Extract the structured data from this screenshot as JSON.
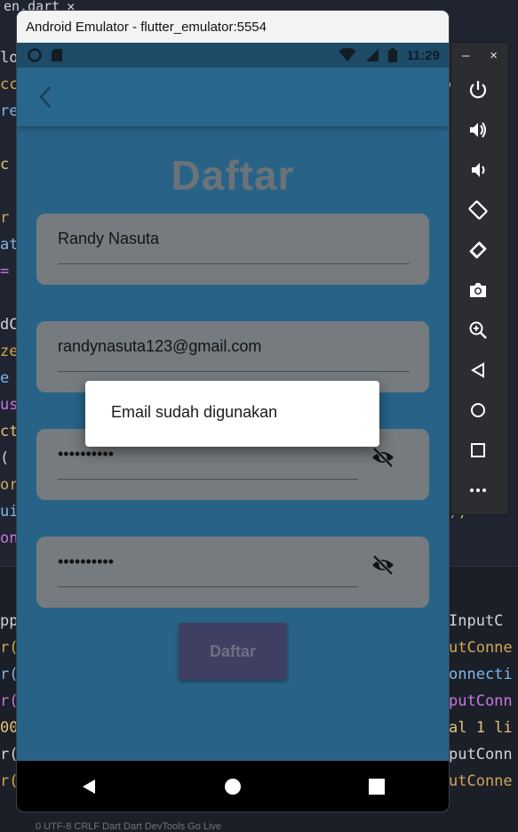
{
  "ide": {
    "tab_label": "en.dart",
    "tab_close": "✕",
    "left_fragments": [
      "lo",
      "cc",
      "re",
      "",
      "c",
      "",
      "r (",
      "at",
      "=",
      "",
      "dC",
      "ze",
      "e",
      "us",
      "ct",
      "(",
      "or",
      "ui",
      "on"
    ],
    "right_fragments": [
      "e",
      "",
      "",
      "",
      "",
      "",
      "",
      "",
      "",
      "",
      "",
      "",
      "",
      "",
      "ry",
      "",
      ");"
    ],
    "panel_left": [
      "pp",
      "r(",
      "r(",
      "r(",
      "00",
      "r(",
      "r("
    ],
    "panel_right": [
      "InputC",
      "utConne",
      "onnecti",
      "putConn",
      "al 1 li",
      "putConn",
      "utConne"
    ],
    "status_text": "0  UTF-8  CRLF  Dart  Dart DevTools  Go Live"
  },
  "window": {
    "title": "Android Emulator - flutter_emulator:5554"
  },
  "status_bar": {
    "time": "11:29"
  },
  "app": {
    "page_title": "Daftar",
    "fields": {
      "name_value": "Randy Nasuta",
      "email_value": "randynasuta123@gmail.com",
      "password_value": "••••••••••",
      "confirm_password_value": "••••••••••"
    },
    "submit_label": "Daftar"
  },
  "dialog": {
    "message": "Email sudah digunakan"
  },
  "toolbar": {
    "minimize": "–",
    "close": "×"
  },
  "colors": {
    "app_bar": "#3c93c7",
    "field_bg": "#aab0b6",
    "button_bg": "#5b5b8f",
    "title_text": "#9aa4ad"
  }
}
